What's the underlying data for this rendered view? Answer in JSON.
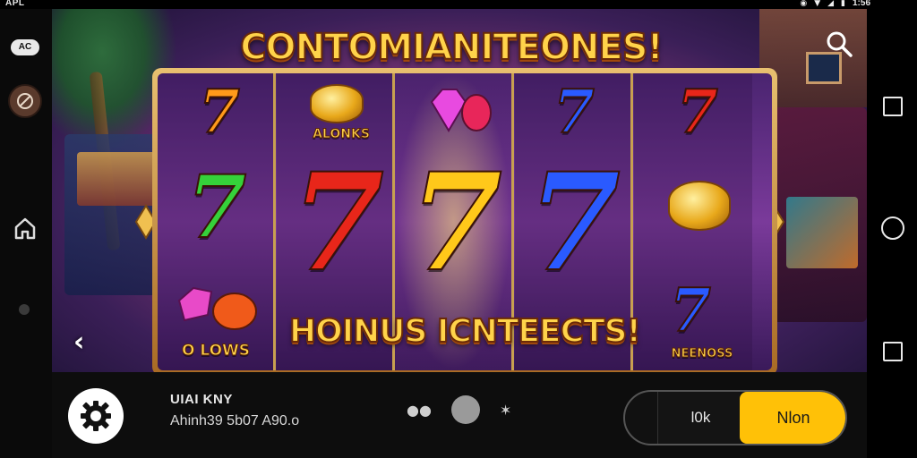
{
  "status_bar": {
    "left_text": "APL",
    "time": "1:56",
    "icons": [
      "location-icon",
      "wifi-icon",
      "signal-icon",
      "battery-icon"
    ]
  },
  "left_rail": {
    "badge_text": "AC",
    "icons": [
      "avatar-icon",
      "home-icon",
      "dot-icon"
    ]
  },
  "game": {
    "title": "CONTOMIANITEONES!",
    "bonus_text": "HOINUS ICNTEECTS!",
    "reel_labels": {
      "coins_top": "ALONKS",
      "bottom_left": "O LOWS",
      "bottom_right": "NEENOSS"
    },
    "symbols": {
      "top_row": [
        "7",
        "7",
        "7",
        "7"
      ],
      "mid_row": [
        "7",
        "7",
        "7",
        "7"
      ],
      "small_bottom": "7"
    },
    "colors": {
      "title_fill": "#ffd34a",
      "frame_gold": "#e8c070",
      "reel_purple": "#4a2470",
      "seven_red": "#e8261a",
      "seven_gold": "#ffc81a",
      "seven_blue": "#2a5aff",
      "seven_green": "#35d13a"
    }
  },
  "bottom_bar": {
    "title": "UIAI KNY",
    "subtitle": "Ahinh39 5b07 A90.o",
    "secondary_button": "l0k",
    "primary_button": "Nlon",
    "accent_color": "#ffc107"
  }
}
